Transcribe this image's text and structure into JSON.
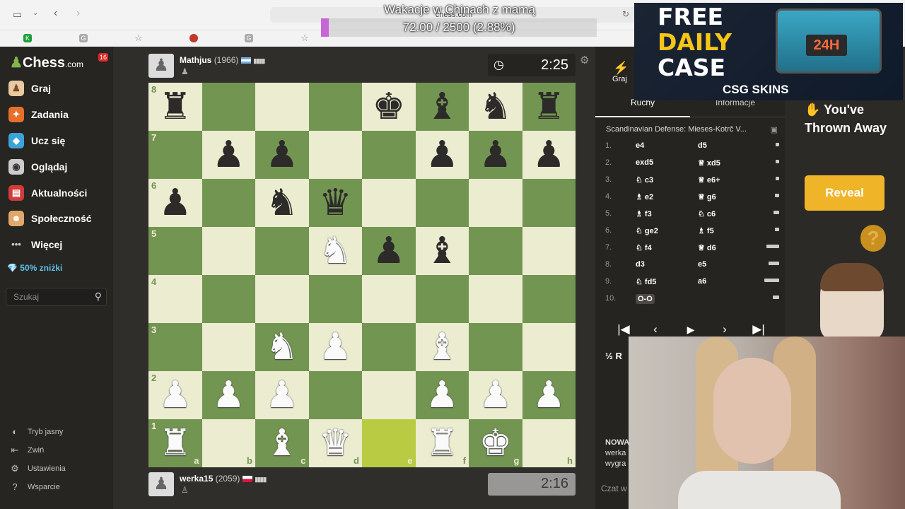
{
  "browser": {
    "url": "chess.com",
    "overlay_title": "Wakacje w Chinach z mamą",
    "overlay_progress_text": "72.00 / 2500 (2.88%)",
    "overlay_progress": 0.0288
  },
  "sidebar": {
    "brand": "Chess",
    "brand_suffix": ".com",
    "notification_count": "16",
    "items": [
      {
        "label": "Graj",
        "icon": "play-icon"
      },
      {
        "label": "Zadania",
        "icon": "puzzle-icon"
      },
      {
        "label": "Ucz się",
        "icon": "learn-icon"
      },
      {
        "label": "Oglądaj",
        "icon": "watch-icon"
      },
      {
        "label": "Aktualności",
        "icon": "news-icon"
      },
      {
        "label": "Społeczność",
        "icon": "community-icon"
      },
      {
        "label": "Więcej",
        "icon": "more-icon"
      }
    ],
    "premium": "50% zniżki",
    "search_placeholder": "Szukaj",
    "bottom": [
      "Tryb jasny",
      "Zwiń",
      "Ustawienia",
      "Wsparcie"
    ]
  },
  "top_player": {
    "name": "Mathjus",
    "rating": "(1966)",
    "clock": "2:25"
  },
  "bottom_player": {
    "name": "werka15",
    "rating": "(2059)",
    "clock": "2:16"
  },
  "board": {
    "ranks": [
      "8",
      "7",
      "6",
      "5",
      "4",
      "3",
      "2",
      "1"
    ],
    "files": [
      "a",
      "b",
      "c",
      "d",
      "e",
      "f",
      "g",
      "h"
    ],
    "highlight": [
      "e1",
      "g1"
    ],
    "pieces": {
      "a8": "br",
      "e8": "bk",
      "f8": "bb",
      "g8": "bn",
      "h8": "br",
      "b7": "bp",
      "c7": "bp",
      "f7": "bp",
      "g7": "bp",
      "h7": "bp",
      "a6": "bp",
      "c6": "bn",
      "d6": "bq",
      "d5": "wn",
      "e5": "bp",
      "f5": "bb",
      "c3": "wn",
      "d3": "wp",
      "f3": "wb",
      "a2": "wp",
      "b2": "wp",
      "c2": "wp",
      "f2": "wp",
      "g2": "wp",
      "h2": "wp",
      "a1": "wr",
      "c1": "wb",
      "d1": "wq",
      "f1": "wr",
      "g1": "wk"
    }
  },
  "panel": {
    "tab_play": "Graj",
    "tab_moves": "Ruchy",
    "tab_info": "Informacje",
    "opening": "Scandinavian Defense: Mieses-Kotrč V...",
    "moves": [
      {
        "n": "1.",
        "w": "e4",
        "b": "d5",
        "wi": "",
        "bi": "",
        "t": 0.05
      },
      {
        "n": "2.",
        "w": "exd5",
        "b": "xd5",
        "wi": "",
        "bi": "♕",
        "t": 0.05
      },
      {
        "n": "3.",
        "w": "c3",
        "b": "e6+",
        "wi": "♘",
        "bi": "♕",
        "t": 0.05
      },
      {
        "n": "4.",
        "w": "e2",
        "b": "g6",
        "wi": "♗",
        "bi": "♕",
        "t": 0.1
      },
      {
        "n": "5.",
        "w": "f3",
        "b": "c6",
        "wi": "♗",
        "bi": "♘",
        "t": 0.15
      },
      {
        "n": "6.",
        "w": "ge2",
        "b": "f5",
        "wi": "♘",
        "bi": "♗",
        "t": 0.1
      },
      {
        "n": "7.",
        "w": "f4",
        "b": "d6",
        "wi": "♘",
        "bi": "♕",
        "t": 0.6
      },
      {
        "n": "8.",
        "w": "d3",
        "b": "e5",
        "wi": "",
        "bi": "",
        "t": 0.45
      },
      {
        "n": "9.",
        "w": "fd5",
        "b": "a6",
        "wi": "♘",
        "bi": "",
        "t": 0.7
      },
      {
        "n": "10.",
        "w": "O-O",
        "b": "",
        "wi": "",
        "bi": "",
        "t": 0.2
      }
    ],
    "half_label": "½ R",
    "news": [
      "NOWA",
      "werka",
      "wygra"
    ],
    "chat_placeholder": "Czat w"
  },
  "ad": {
    "line1": "FREE",
    "line2": "DAILY",
    "line3": "CASE",
    "box_text": "24H",
    "logo": "CSG SKINS",
    "thrown": "You've Thrown Away",
    "reveal": "Reveal"
  }
}
